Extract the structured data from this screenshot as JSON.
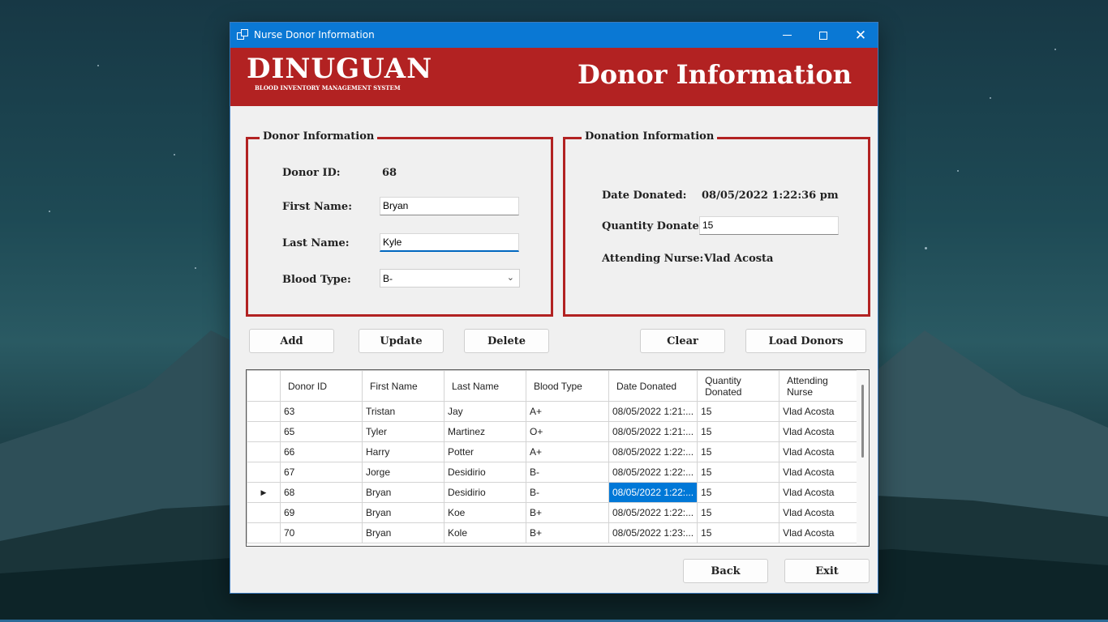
{
  "window": {
    "title": "Nurse Donor Information"
  },
  "header": {
    "brand": "DINUGUAN",
    "brand_subtitle": "BLOOD INVENTORY MANAGEMENT SYSTEM",
    "title": "Donor Information"
  },
  "donor_group": {
    "legend": "Donor Information",
    "donor_id_label": "Donor ID:",
    "donor_id_value": "68",
    "first_name_label": "First Name:",
    "first_name_value": "Bryan",
    "last_name_label": "Last Name:",
    "last_name_value": "Kyle",
    "blood_type_label": "Blood Type:",
    "blood_type_value": "B-"
  },
  "donation_group": {
    "legend": "Donation Information",
    "date_label": "Date Donated:",
    "date_value": "08/05/2022 1:22:36 pm",
    "quantity_label": "Quantity Donated:",
    "quantity_value": "15",
    "nurse_label": "Attending Nurse:",
    "nurse_value": "Vlad Acosta"
  },
  "buttons": {
    "add": "Add",
    "update": "Update",
    "delete": "Delete",
    "clear": "Clear",
    "load": "Load Donors",
    "back": "Back",
    "exit": "Exit"
  },
  "grid": {
    "columns": [
      "Donor ID",
      "First Name",
      "Last Name",
      "Blood Type",
      "Date Donated",
      "Quantity Donated",
      "Attending Nurse"
    ],
    "current_row_marker": "▶",
    "rows": [
      [
        "63",
        "Tristan",
        "Jay",
        "A+",
        "08/05/2022 1:21:...",
        "15",
        "Vlad Acosta"
      ],
      [
        "65",
        "Tyler",
        "Martinez",
        "O+",
        "08/05/2022 1:21:...",
        "15",
        "Vlad Acosta"
      ],
      [
        "66",
        "Harry",
        "Potter",
        "A+",
        "08/05/2022 1:22:...",
        "15",
        "Vlad Acosta"
      ],
      [
        "67",
        "Jorge",
        "Desidirio",
        "B-",
        "08/05/2022 1:22:...",
        "15",
        "Vlad Acosta"
      ],
      [
        "68",
        "Bryan",
        "Desidirio",
        "B-",
        "08/05/2022 1:22:...",
        "15",
        "Vlad Acosta"
      ],
      [
        "69",
        "Bryan",
        "Koe",
        "B+",
        "08/05/2022 1:22:...",
        "15",
        "Vlad Acosta"
      ],
      [
        "70",
        "Bryan",
        "Kole",
        "B+",
        "08/05/2022 1:23:...",
        "15",
        "Vlad Acosta"
      ]
    ],
    "current_row": 4,
    "selected_column": 4
  },
  "colors": {
    "accent": "#b22222",
    "titlebar": "#0a78d4",
    "selection": "#0078d7"
  }
}
